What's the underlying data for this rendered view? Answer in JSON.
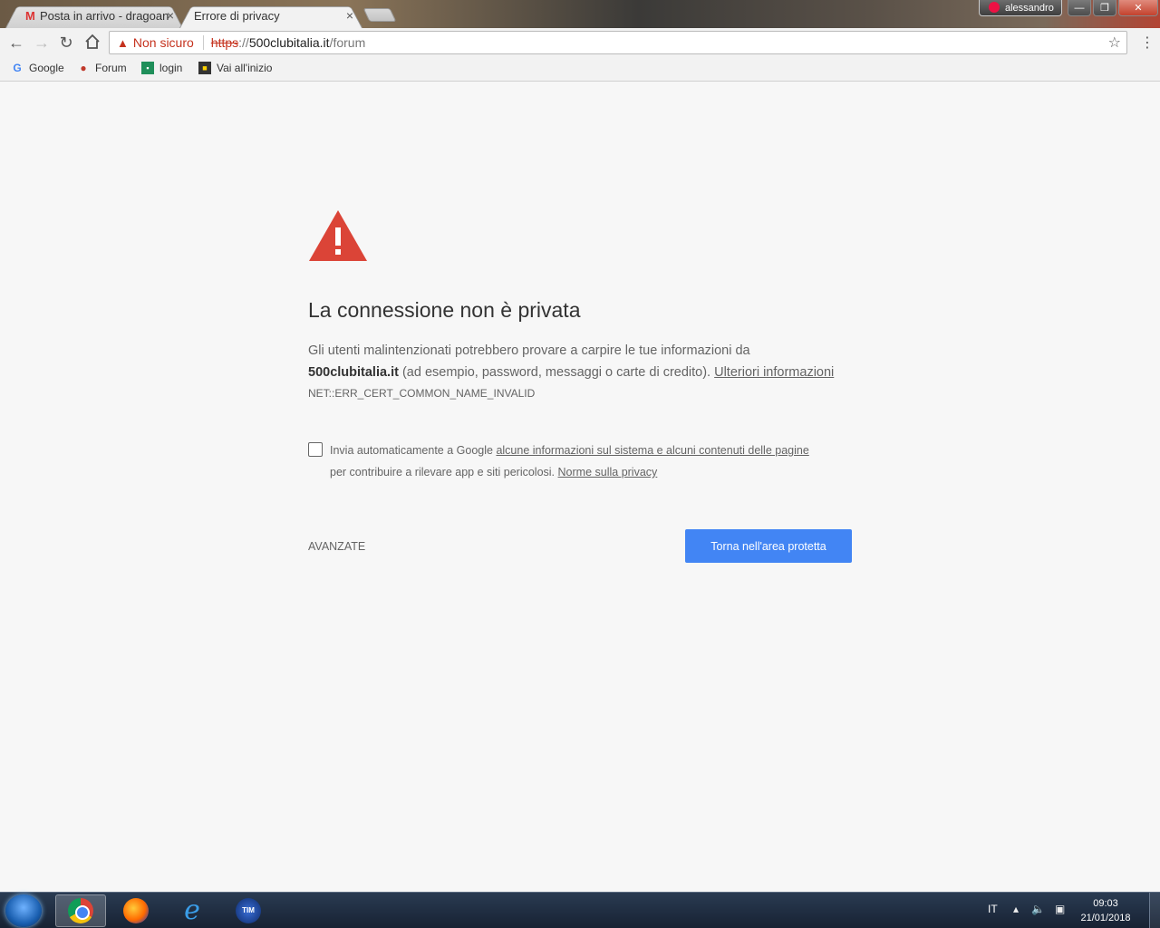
{
  "browser": {
    "tabs": [
      {
        "title": "Posta in arrivo - dragoan",
        "icon": "gmail-icon",
        "active": false
      },
      {
        "title": "Errore di privacy",
        "icon": "",
        "active": true
      }
    ],
    "tab_close_glyph": "×",
    "profile_name": "alessandro",
    "window_buttons": {
      "minimize": "—",
      "restore": "❐",
      "close": "✕"
    }
  },
  "toolbar": {
    "security_label": "Non sicuro",
    "url_scheme": "https",
    "url_separator": "://",
    "url_host": "500clubitalia.it",
    "url_path": "/forum"
  },
  "bookmarks": [
    {
      "label": "Google",
      "icon": "google-icon"
    },
    {
      "label": "Forum",
      "icon": "car-icon"
    },
    {
      "label": "login",
      "icon": "login-icon"
    },
    {
      "label": "Vai all'inizio",
      "icon": "home-bookmark-icon"
    }
  ],
  "interstitial": {
    "heading": "La connessione non è privata",
    "paragraph_start": "Gli utenti malintenzionati potrebbero provare a carpire le tue informazioni da",
    "paragraph_host": "500clubitalia.it",
    "paragraph_end": "(ad esempio, password, messaggi o carte di credito).",
    "learn_more": "Ulteriori informazioni",
    "error_code": "NET::ERR_CERT_COMMON_NAME_INVALID",
    "optin_text_start": "Invia automaticamente a Google",
    "optin_link": "alcune informazioni sul sistema e alcuni contenuti delle pagine",
    "optin_text_end": "per contribuire a rilevare app e siti pericolosi.",
    "privacy_link": "Norme sulla privacy",
    "advanced_button": "AVANZATE",
    "back_button": "Torna nell'area protetta",
    "accent_color": "#4285f4",
    "warning_color": "#db4437"
  },
  "taskbar": {
    "apps": [
      "chrome-icon",
      "firefox-icon",
      "internet-explorer-icon",
      "tim-icon"
    ],
    "language": "IT",
    "time": "09:03",
    "date": "21/01/2018"
  }
}
